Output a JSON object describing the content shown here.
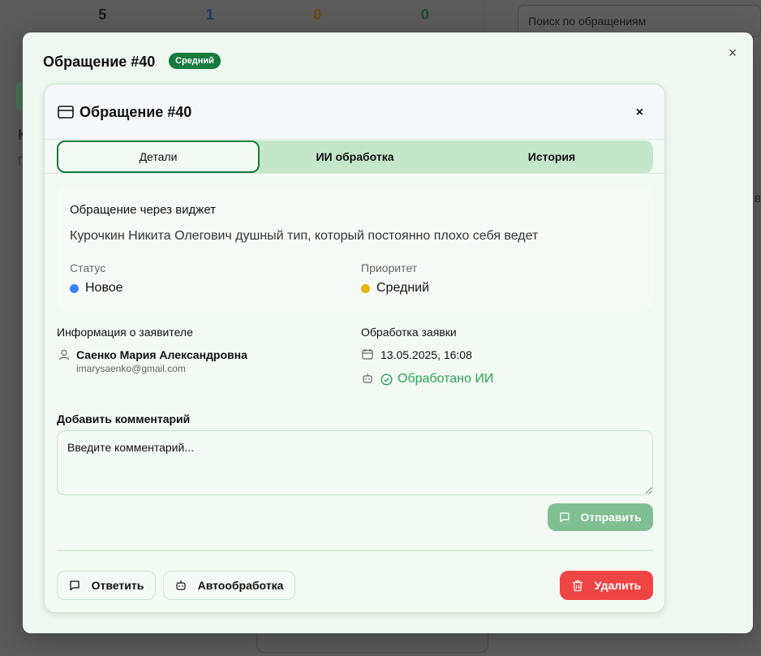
{
  "background": {
    "stats": [
      {
        "value": "5",
        "color": "#1b1b1b"
      },
      {
        "value": "1",
        "color": "#1e3a6e"
      },
      {
        "value": "0",
        "color": "#6a4b10"
      },
      {
        "value": "0",
        "color": "#1d4a33"
      }
    ],
    "search_placeholder": "Поиск по обращениям",
    "fragment_k": "К",
    "fragment_p": "П",
    "fragment_b": "в"
  },
  "modal": {
    "title": "Обращение #40",
    "badge": "Средний",
    "close_glyph": "×"
  },
  "card": {
    "title": "Обращение #40",
    "close_glyph": "×",
    "tabs": [
      {
        "label": "Детали"
      },
      {
        "label": "ИИ обработка"
      },
      {
        "label": "История"
      }
    ]
  },
  "details": {
    "title": "Обращение через виджет",
    "description": "Курочкин Никита Олегович душный тип, который постоянно плохо себя ведет",
    "status_label": "Статус",
    "status_value": "Новое",
    "status_color": "#3b82f6",
    "priority_label": "Приоритет",
    "priority_value": "Средний",
    "priority_color": "#eab308"
  },
  "applicant": {
    "heading": "Информация о заявителе",
    "name": "Саенко Мария Александровна",
    "email": "imarysaenko@gmail.com"
  },
  "processing": {
    "heading": "Обработка заявки",
    "date": "13.05.2025, 16:08",
    "ai_status": "Обработано ИИ"
  },
  "comment": {
    "label": "Добавить комментарий",
    "placeholder": "Введите комментарий...",
    "send_label": "Отправить"
  },
  "actions": {
    "reply_label": "Ответить",
    "auto_label": "Автообработка",
    "delete_label": "Удалить"
  },
  "colors": {
    "accent": "#187a3e",
    "success": "#2ea357",
    "danger": "#ef4444"
  }
}
